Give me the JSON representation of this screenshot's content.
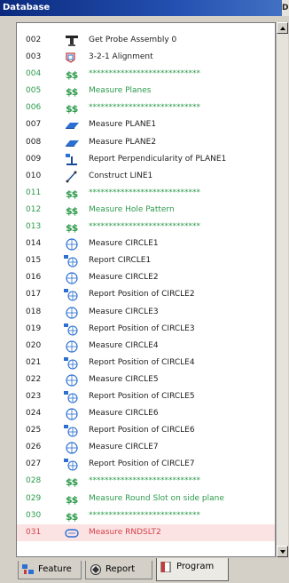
{
  "window": {
    "title": "Database",
    "edge_char": "D"
  },
  "rows": [
    {
      "num": "002",
      "label": "Get Probe Assembly 0",
      "icon": "probe-assembly-icon",
      "type": "cmd"
    },
    {
      "num": "003",
      "label": "3-2-1 Alignment",
      "icon": "alignment-icon",
      "type": "cmd"
    },
    {
      "num": "004",
      "label": "****************************",
      "icon": "comment-icon",
      "type": "cmt"
    },
    {
      "num": "005",
      "label": "Measure Planes",
      "icon": "comment-icon",
      "type": "cmt"
    },
    {
      "num": "006",
      "label": "****************************",
      "icon": "comment-icon",
      "type": "cmt"
    },
    {
      "num": "007",
      "label": "Measure PLANE1",
      "icon": "plane-icon",
      "type": "cmd"
    },
    {
      "num": "008",
      "label": "Measure PLANE2",
      "icon": "plane-icon",
      "type": "cmd"
    },
    {
      "num": "009",
      "label": "Report Perpendicularity of PLANE1",
      "icon": "perpendicularity-icon",
      "type": "cmd"
    },
    {
      "num": "010",
      "label": "Construct LINE1",
      "icon": "construct-line-icon",
      "type": "cmd"
    },
    {
      "num": "011",
      "label": "****************************",
      "icon": "comment-icon",
      "type": "cmt"
    },
    {
      "num": "012",
      "label": "Measure Hole Pattern",
      "icon": "comment-icon",
      "type": "cmt"
    },
    {
      "num": "013",
      "label": "****************************",
      "icon": "comment-icon",
      "type": "cmt"
    },
    {
      "num": "014",
      "label": "Measure CIRCLE1",
      "icon": "circle-icon",
      "type": "cmd"
    },
    {
      "num": "015",
      "label": "Report CIRCLE1",
      "icon": "report-circle-icon",
      "type": "cmd"
    },
    {
      "num": "016",
      "label": "Measure CIRCLE2",
      "icon": "circle-icon",
      "type": "cmd"
    },
    {
      "num": "017",
      "label": "Report Position of CIRCLE2",
      "icon": "report-circle-icon",
      "type": "cmd"
    },
    {
      "num": "018",
      "label": "Measure CIRCLE3",
      "icon": "circle-icon",
      "type": "cmd"
    },
    {
      "num": "019",
      "label": "Report Position of CIRCLE3",
      "icon": "report-circle-icon",
      "type": "cmd"
    },
    {
      "num": "020",
      "label": "Measure CIRCLE4",
      "icon": "circle-icon",
      "type": "cmd"
    },
    {
      "num": "021",
      "label": "Report Position of CIRCLE4",
      "icon": "report-circle-icon",
      "type": "cmd"
    },
    {
      "num": "022",
      "label": "Measure CIRCLE5",
      "icon": "circle-icon",
      "type": "cmd"
    },
    {
      "num": "023",
      "label": "Report Position of CIRCLE5",
      "icon": "report-circle-icon",
      "type": "cmd"
    },
    {
      "num": "024",
      "label": "Measure CIRCLE6",
      "icon": "circle-icon",
      "type": "cmd"
    },
    {
      "num": "025",
      "label": "Report Position of CIRCLE6",
      "icon": "report-circle-icon",
      "type": "cmd"
    },
    {
      "num": "026",
      "label": "Measure CIRCLE7",
      "icon": "circle-icon",
      "type": "cmd"
    },
    {
      "num": "027",
      "label": "Report Position of CIRCLE7",
      "icon": "report-circle-icon",
      "type": "cmd"
    },
    {
      "num": "028",
      "label": "****************************",
      "icon": "comment-icon",
      "type": "cmt"
    },
    {
      "num": "029",
      "label": "Measure Round Slot on side plane",
      "icon": "comment-icon",
      "type": "cmt"
    },
    {
      "num": "030",
      "label": "****************************",
      "icon": "comment-icon",
      "type": "cmt"
    },
    {
      "num": "031",
      "label": "Measure RNDSLT2",
      "icon": "slot-icon",
      "type": "hl"
    }
  ],
  "comment_glyph": "$$",
  "tabs": [
    {
      "label": "Feature",
      "icon": "feature-tab-icon",
      "active": false
    },
    {
      "label": "Report",
      "icon": "report-tab-icon",
      "active": false
    },
    {
      "label": "Program",
      "icon": "program-tab-icon",
      "active": true
    }
  ],
  "colors": {
    "comment": "#2c9a4b",
    "highlight": "#d6414a",
    "highlight_bg": "#fbe3e3",
    "icon_blue": "#2a6fd1",
    "title_bar": "#0b2a7e"
  }
}
